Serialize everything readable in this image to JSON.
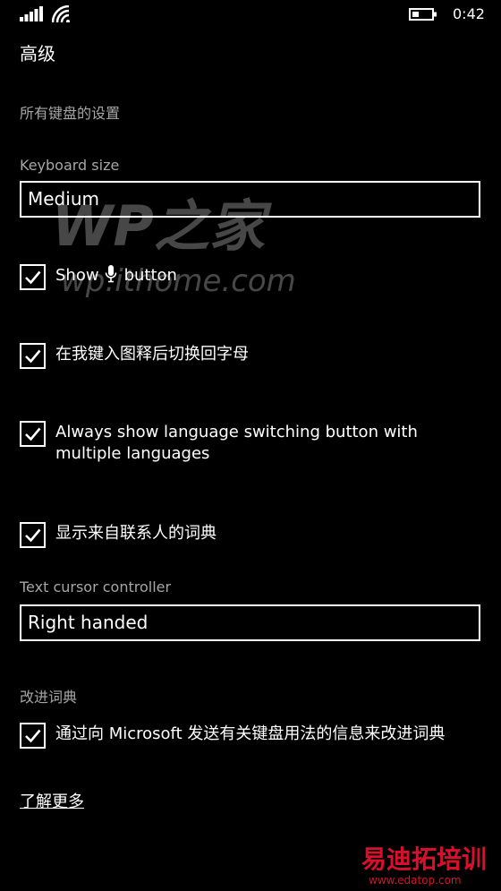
{
  "status_bar": {
    "time": "0:42"
  },
  "header": {
    "title": "高级"
  },
  "sections": {
    "all_keyboards": "所有键盘的设置",
    "improve_dictionary": "改进词典"
  },
  "keyboard_size": {
    "label": "Keyboard size",
    "value": "Medium"
  },
  "show_mic_button": {
    "checked": true,
    "label_before": "Show",
    "label_after": "button"
  },
  "switch_back_after_emoji": {
    "checked": true,
    "label": "在我键入图释后切换回字母"
  },
  "language_switch_button": {
    "checked": true,
    "label": "Always show language switching button with multiple languages"
  },
  "contacts_dictionary": {
    "checked": true,
    "label": "显示来自联系人的词典"
  },
  "text_cursor_controller": {
    "label": "Text cursor controller",
    "value": "Right handed"
  },
  "send_usage_info": {
    "checked": true,
    "label": "通过向 Microsoft 发送有关键盘用法的信息来改进词典"
  },
  "learn_more": {
    "label": "了解更多"
  },
  "watermark": {
    "main": "WP之家",
    "sub": "wp.ithome.com"
  },
  "corner_logo": {
    "main": "易迪拓培训",
    "sub": "www.edatop.com"
  },
  "colors": {
    "background": "#000000",
    "foreground": "#ffffff",
    "secondary_text": "#a6a6a6",
    "corner_logo": "#d9102b"
  },
  "icons": {
    "signal": "signal-icon",
    "wifi": "wifi-icon",
    "battery": "battery-icon",
    "microphone": "microphone-icon",
    "checkmark": "checkmark-icon"
  }
}
